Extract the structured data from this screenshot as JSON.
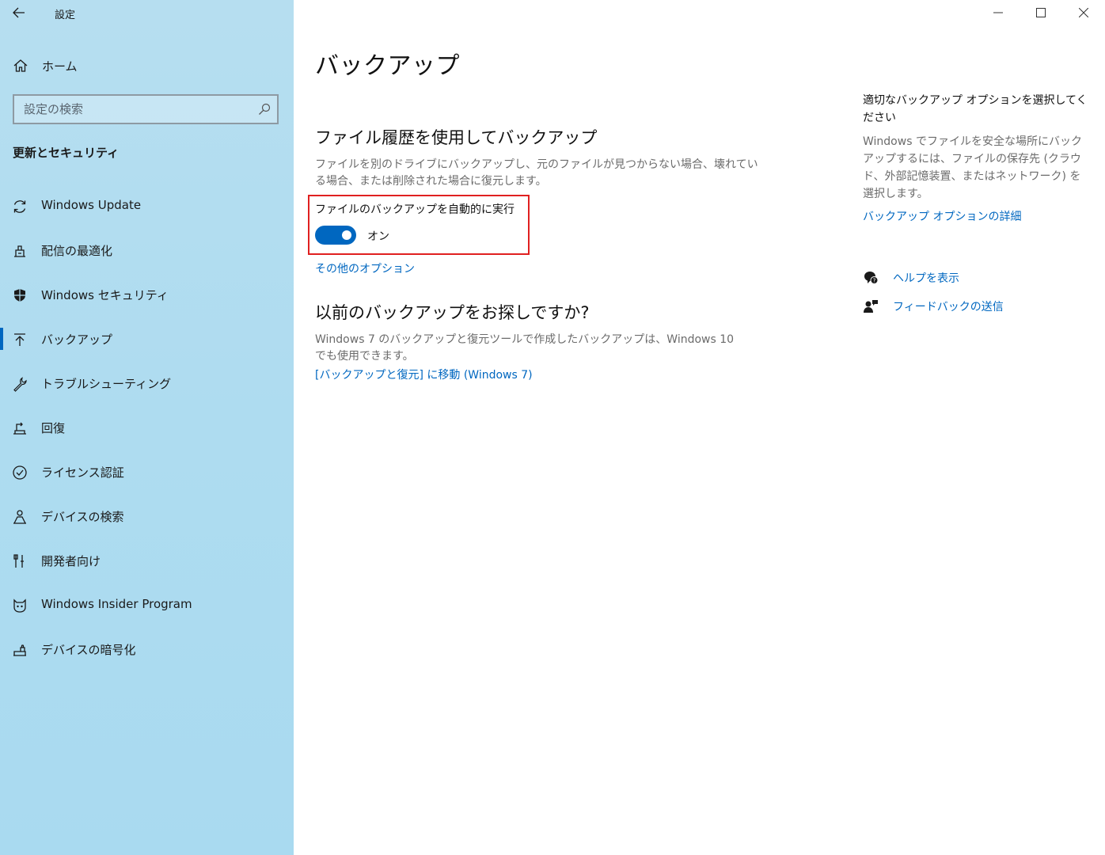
{
  "window": {
    "app_title": "設定",
    "controls": {
      "minimize": "—",
      "maximize": "☐",
      "close": "✕"
    }
  },
  "sidebar": {
    "home_label": "ホーム",
    "search_placeholder": "設定の検索",
    "section_title": "更新とセキュリティ",
    "items": [
      {
        "label": "Windows Update",
        "icon": "refresh-icon"
      },
      {
        "label": "配信の最適化",
        "icon": "delivery-icon"
      },
      {
        "label": "Windows セキュリティ",
        "icon": "shield-icon"
      },
      {
        "label": "バックアップ",
        "icon": "backup-arrow-icon",
        "active": true
      },
      {
        "label": "トラブルシューティング",
        "icon": "wrench-icon"
      },
      {
        "label": "回復",
        "icon": "recovery-icon"
      },
      {
        "label": "ライセンス認証",
        "icon": "check-circle-icon"
      },
      {
        "label": "デバイスの検索",
        "icon": "person-location-icon"
      },
      {
        "label": "開発者向け",
        "icon": "developer-tools-icon"
      },
      {
        "label": "Windows Insider Program",
        "icon": "insider-cat-icon"
      },
      {
        "label": "デバイスの暗号化",
        "icon": "encryption-icon"
      }
    ]
  },
  "main": {
    "page_title": "バックアップ",
    "file_history": {
      "heading": "ファイル履歴を使用してバックアップ",
      "description_line1": "ファイルを別のドライブにバックアップし、元のファイルが見つからない場合、壊れてい",
      "description_line2": "る場合、または削除された場合に復元します。",
      "toggle_label": "ファイルのバックアップを自動的に実行",
      "toggle_state": "オン",
      "toggle_on": true,
      "more_options": "その他のオプション"
    },
    "older_backup": {
      "heading": "以前のバックアップをお探しですか?",
      "description_line1": "Windows 7 のバックアップと復元ツールで作成したバックアップは、Windows 10",
      "description_line2": "でも使用できます。",
      "link": "[バックアップと復元] に移動 (Windows 7)"
    }
  },
  "rail": {
    "title": "適切なバックアップ オプションを選択してください",
    "description": "Windows でファイルを安全な場所にバックアップするには、ファイルの保存先 (クラウド、外部記憶装置、またはネットワーク) を選択します。",
    "details_link": "バックアップ オプションの詳細",
    "help_label": "ヘルプを表示",
    "feedback_label": "フィードバックの送信"
  },
  "colors": {
    "accent": "#0067c0",
    "highlight_border": "#e02020",
    "sidebar_bg": "#aedcf0"
  }
}
